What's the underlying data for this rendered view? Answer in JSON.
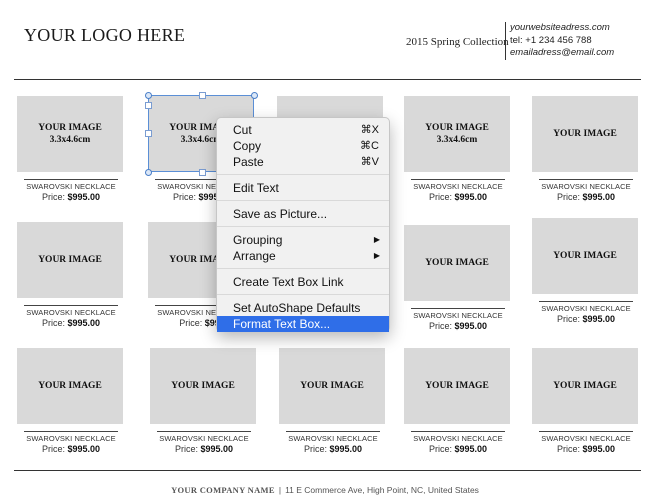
{
  "header": {
    "logo": "YOUR LOGO HERE",
    "collection": "2015 Spring Collection",
    "contact": {
      "website": "yourwebsiteadress.com",
      "tel": "tel: +1 234 456 788",
      "email": "emailadress@email.com"
    }
  },
  "grid": {
    "rows": [
      [
        {
          "image_label": "YOUR IMAGE",
          "image_size": "3.3x4.6cm",
          "name": "SWAROVSKI NECKLACE",
          "price_prefix": "Price:",
          "price": "$995.00"
        },
        {
          "image_label": "YOUR IMAGE",
          "image_size": "3.3x4.6cm",
          "name": "SWAROVSKI NECKLACE",
          "price_prefix": "Price:",
          "price": "$995.00"
        },
        {
          "image_label": "",
          "image_size": "",
          "name": "",
          "price_prefix": "",
          "price": ""
        },
        {
          "image_label": "YOUR IMAGE",
          "image_size": "3.3x4.6cm",
          "name": "SWAROVSKI NECKLACE",
          "price_prefix": "Price:",
          "price": "$995.00"
        },
        {
          "image_label": "YOUR IMAGE",
          "image_size": "",
          "name": "SWAROVSKI NECKLACE",
          "price_prefix": "Price:",
          "price": "$995.00"
        }
      ],
      [
        {
          "image_label": "YOUR IMAGE",
          "image_size": "",
          "name": "SWAROVSKI NECKLACE",
          "price_prefix": "Price:",
          "price": "$995.00"
        },
        {
          "image_label": "YOUR IMAGE",
          "image_size": "",
          "name": "SWAROVSKI NECKLACE",
          "price_prefix": "Price:",
          "price": "$995"
        },
        {
          "image_label": "",
          "image_size": "",
          "name": "",
          "price_prefix": "",
          "price": ""
        },
        {
          "image_label": "YOUR IMAGE",
          "image_size": "",
          "name": "SWAROVSKI NECKLACE",
          "price_prefix": "Price:",
          "price": "$995.00"
        },
        {
          "image_label": "YOUR IMAGE",
          "image_size": "",
          "name": "SWAROVSKI NECKLACE",
          "price_prefix": "Price:",
          "price": "$995.00"
        }
      ],
      [
        {
          "image_label": "YOUR IMAGE",
          "image_size": "",
          "name": "SWAROVSKI NECKLACE",
          "price_prefix": "Price:",
          "price": "$995.00"
        },
        {
          "image_label": "YOUR IMAGE",
          "image_size": "",
          "name": "SWAROVSKI NECKLACE",
          "price_prefix": "Price:",
          "price": "$995.00"
        },
        {
          "image_label": "YOUR IMAGE",
          "image_size": "",
          "name": "SWAROVSKI NECKLACE",
          "price_prefix": "Price:",
          "price": "$995.00"
        },
        {
          "image_label": "YOUR IMAGE",
          "image_size": "",
          "name": "SWAROVSKI NECKLACE",
          "price_prefix": "Price:",
          "price": "$995.00"
        },
        {
          "image_label": "YOUR IMAGE",
          "image_size": "",
          "name": "SWAROVSKI NECKLACE",
          "price_prefix": "Price:",
          "price": "$995.00"
        }
      ]
    ]
  },
  "context_menu": {
    "items": [
      {
        "label": "Cut",
        "shortcut": "⌘X"
      },
      {
        "label": "Copy",
        "shortcut": "⌘C"
      },
      {
        "label": "Paste",
        "shortcut": "⌘V"
      },
      {
        "label": "Edit Text"
      },
      {
        "label": "Save as Picture..."
      },
      {
        "label": "Grouping",
        "submenu_icon": "submenu-arrow-icon"
      },
      {
        "label": "Arrange",
        "submenu_icon": "submenu-arrow-icon"
      },
      {
        "label": "Create Text Box Link"
      },
      {
        "label": "Set AutoShape Defaults"
      },
      {
        "label": "Format Text Box...",
        "highlighted": true
      }
    ],
    "highlight_color": "#2f6ee8"
  },
  "footer": {
    "company": "YOUR COMPANY NAME",
    "separator": "|",
    "address": "11 E Commerce Ave, High Point, NC, United States"
  }
}
